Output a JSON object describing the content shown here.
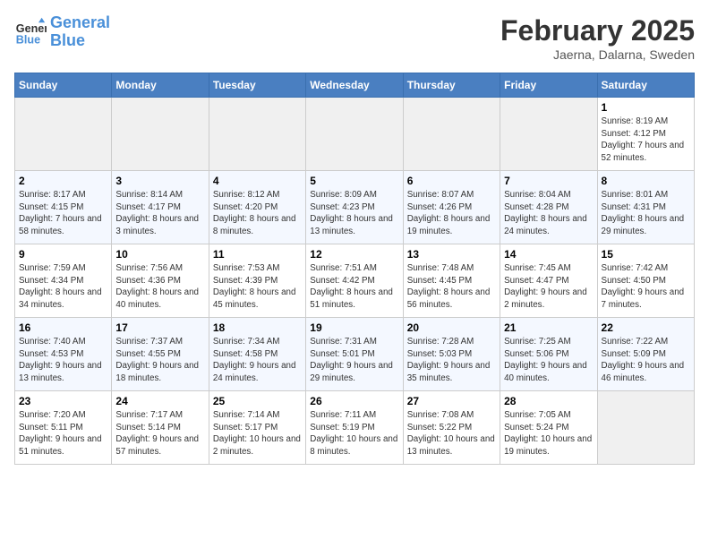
{
  "header": {
    "logo_line1": "General",
    "logo_line2": "Blue",
    "month_title": "February 2025",
    "subtitle": "Jaerna, Dalarna, Sweden"
  },
  "weekdays": [
    "Sunday",
    "Monday",
    "Tuesday",
    "Wednesday",
    "Thursday",
    "Friday",
    "Saturday"
  ],
  "weeks": [
    [
      {
        "num": "",
        "info": ""
      },
      {
        "num": "",
        "info": ""
      },
      {
        "num": "",
        "info": ""
      },
      {
        "num": "",
        "info": ""
      },
      {
        "num": "",
        "info": ""
      },
      {
        "num": "",
        "info": ""
      },
      {
        "num": "1",
        "info": "Sunrise: 8:19 AM\nSunset: 4:12 PM\nDaylight: 7 hours and 52 minutes."
      }
    ],
    [
      {
        "num": "2",
        "info": "Sunrise: 8:17 AM\nSunset: 4:15 PM\nDaylight: 7 hours and 58 minutes."
      },
      {
        "num": "3",
        "info": "Sunrise: 8:14 AM\nSunset: 4:17 PM\nDaylight: 8 hours and 3 minutes."
      },
      {
        "num": "4",
        "info": "Sunrise: 8:12 AM\nSunset: 4:20 PM\nDaylight: 8 hours and 8 minutes."
      },
      {
        "num": "5",
        "info": "Sunrise: 8:09 AM\nSunset: 4:23 PM\nDaylight: 8 hours and 13 minutes."
      },
      {
        "num": "6",
        "info": "Sunrise: 8:07 AM\nSunset: 4:26 PM\nDaylight: 8 hours and 19 minutes."
      },
      {
        "num": "7",
        "info": "Sunrise: 8:04 AM\nSunset: 4:28 PM\nDaylight: 8 hours and 24 minutes."
      },
      {
        "num": "8",
        "info": "Sunrise: 8:01 AM\nSunset: 4:31 PM\nDaylight: 8 hours and 29 minutes."
      }
    ],
    [
      {
        "num": "9",
        "info": "Sunrise: 7:59 AM\nSunset: 4:34 PM\nDaylight: 8 hours and 34 minutes."
      },
      {
        "num": "10",
        "info": "Sunrise: 7:56 AM\nSunset: 4:36 PM\nDaylight: 8 hours and 40 minutes."
      },
      {
        "num": "11",
        "info": "Sunrise: 7:53 AM\nSunset: 4:39 PM\nDaylight: 8 hours and 45 minutes."
      },
      {
        "num": "12",
        "info": "Sunrise: 7:51 AM\nSunset: 4:42 PM\nDaylight: 8 hours and 51 minutes."
      },
      {
        "num": "13",
        "info": "Sunrise: 7:48 AM\nSunset: 4:45 PM\nDaylight: 8 hours and 56 minutes."
      },
      {
        "num": "14",
        "info": "Sunrise: 7:45 AM\nSunset: 4:47 PM\nDaylight: 9 hours and 2 minutes."
      },
      {
        "num": "15",
        "info": "Sunrise: 7:42 AM\nSunset: 4:50 PM\nDaylight: 9 hours and 7 minutes."
      }
    ],
    [
      {
        "num": "16",
        "info": "Sunrise: 7:40 AM\nSunset: 4:53 PM\nDaylight: 9 hours and 13 minutes."
      },
      {
        "num": "17",
        "info": "Sunrise: 7:37 AM\nSunset: 4:55 PM\nDaylight: 9 hours and 18 minutes."
      },
      {
        "num": "18",
        "info": "Sunrise: 7:34 AM\nSunset: 4:58 PM\nDaylight: 9 hours and 24 minutes."
      },
      {
        "num": "19",
        "info": "Sunrise: 7:31 AM\nSunset: 5:01 PM\nDaylight: 9 hours and 29 minutes."
      },
      {
        "num": "20",
        "info": "Sunrise: 7:28 AM\nSunset: 5:03 PM\nDaylight: 9 hours and 35 minutes."
      },
      {
        "num": "21",
        "info": "Sunrise: 7:25 AM\nSunset: 5:06 PM\nDaylight: 9 hours and 40 minutes."
      },
      {
        "num": "22",
        "info": "Sunrise: 7:22 AM\nSunset: 5:09 PM\nDaylight: 9 hours and 46 minutes."
      }
    ],
    [
      {
        "num": "23",
        "info": "Sunrise: 7:20 AM\nSunset: 5:11 PM\nDaylight: 9 hours and 51 minutes."
      },
      {
        "num": "24",
        "info": "Sunrise: 7:17 AM\nSunset: 5:14 PM\nDaylight: 9 hours and 57 minutes."
      },
      {
        "num": "25",
        "info": "Sunrise: 7:14 AM\nSunset: 5:17 PM\nDaylight: 10 hours and 2 minutes."
      },
      {
        "num": "26",
        "info": "Sunrise: 7:11 AM\nSunset: 5:19 PM\nDaylight: 10 hours and 8 minutes."
      },
      {
        "num": "27",
        "info": "Sunrise: 7:08 AM\nSunset: 5:22 PM\nDaylight: 10 hours and 13 minutes."
      },
      {
        "num": "28",
        "info": "Sunrise: 7:05 AM\nSunset: 5:24 PM\nDaylight: 10 hours and 19 minutes."
      },
      {
        "num": "",
        "info": ""
      }
    ]
  ]
}
